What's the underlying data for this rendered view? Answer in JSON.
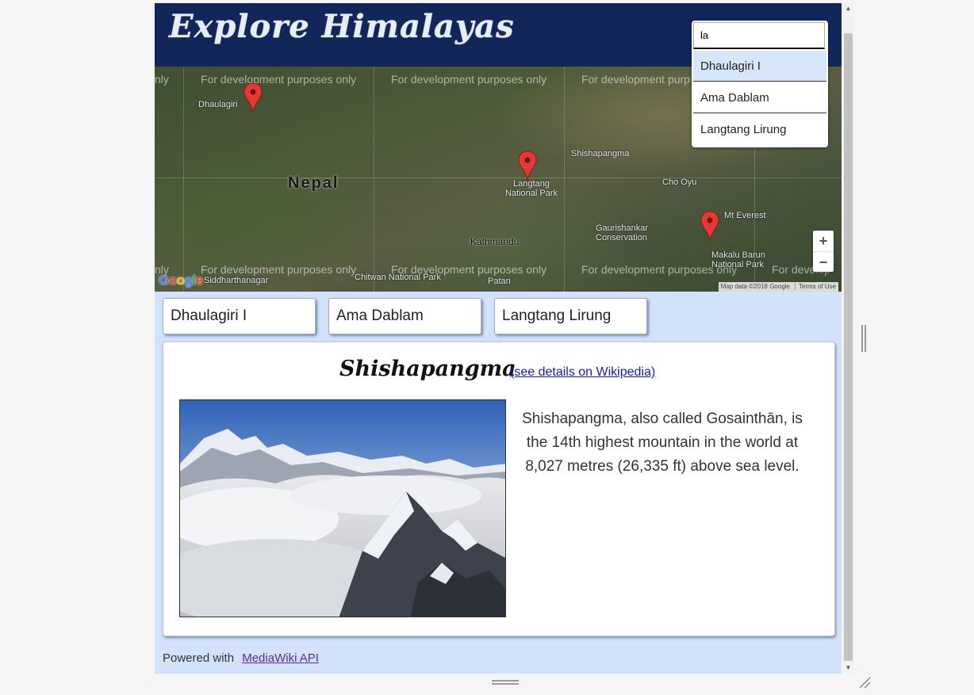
{
  "header": {
    "title": "Explore Himalayas"
  },
  "search": {
    "value": "la",
    "suggestions": [
      "Dhaulagiri I",
      "Ama Dablam",
      "Langtang Lirung"
    ],
    "active_index": 0
  },
  "map": {
    "watermark": "For development purposes only",
    "watermark_partial_left": "nly",
    "watermark_partial_mid": "For development purp",
    "watermark_partial_right": "For develop",
    "country_label": "Nepal",
    "places": [
      "Dhaulagiri",
      "Shishapangma",
      "Cho Oyu",
      "Mt Everest",
      "Kathmandu",
      "Chitwan National Park",
      "Siddharthanagar",
      "Patan",
      "Langtang National Park",
      "Gaurishankar Conservation",
      "Makalu Barun National Park"
    ],
    "zoom_in_label": "+",
    "zoom_out_label": "−",
    "logo": "Google",
    "attribution": "Map data ©2018 Google",
    "terms": "Terms of Use",
    "marker_count": 3
  },
  "peak_buttons": [
    "Dhaulagiri I",
    "Ama Dablam",
    "Langtang Lirung"
  ],
  "card": {
    "title": "Shishapangma",
    "link": "(see details on Wikipedia)",
    "description": "Shishapangma, also called Gosainthān, is the 14th highest mountain in the world at 8,027 metres (26,335 ft) above sea level."
  },
  "footer": {
    "prefix": "Powered with",
    "link": "MediaWiki API"
  },
  "colors": {
    "header_bg": "#12265a",
    "page_bg": "#d2e2fb",
    "marker": "#e53935",
    "link": "#1a1aa8"
  }
}
